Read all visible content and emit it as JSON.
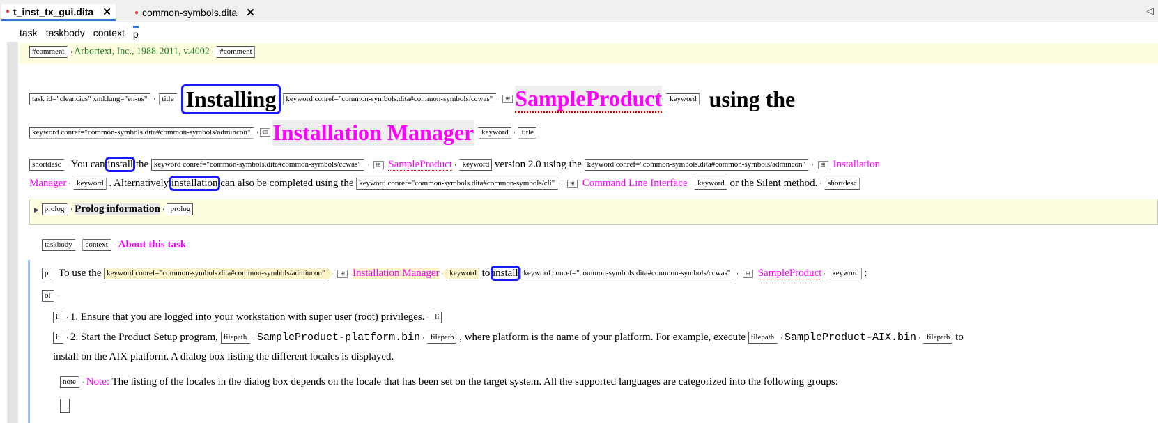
{
  "tabs": [
    {
      "label": "t_inst_tx_gui.dita"
    },
    {
      "label": "common-symbols.dita"
    }
  ],
  "scroll_arrow": "◁",
  "breadcrumb": [
    "task",
    "taskbody",
    "context",
    "p"
  ],
  "comment": {
    "tag": "#comment",
    "text": "Arbortext, Inc., 1988-2011, v.4002"
  },
  "title_line": {
    "task_tag": "task id=\"cleancics\" xml:lang=\"en-us\"",
    "title_tag": "title",
    "word1": "Installing",
    "kw1_tag": "keyword conref=\"common-symbols.dita#common-symbols/ccwas\"",
    "kw1": "SampleProduct",
    "kw_close": "keyword",
    "word2": "using the",
    "kw2_tag": "keyword conref=\"common-symbols.dita#common-symbols/admincon\"",
    "kw2": "Installation Manager",
    "title_close": "title"
  },
  "shortdesc": {
    "tag": "shortdesc",
    "t1": "You can",
    "install": "install",
    "t2": "the",
    "kw1_tag": "keyword conref=\"common-symbols.dita#common-symbols/ccwas\"",
    "kw1": "SampleProduct",
    "t3": "version 2.0 using the",
    "kw2_tag": "keyword conref=\"common-symbols.dita#common-symbols/admincon\"",
    "kw2a": "Installation",
    "kw2b": "Manager",
    "t4": ". Alternatively",
    "installation": "installation",
    "t5": "can also be completed using the",
    "kw3_tag": "keyword conref=\"common-symbols.dita#common-symbols/cli\"",
    "kw3": "Command Line Interface",
    "t6": "or the Silent method.",
    "kw_close": "keyword",
    "close": "shortdesc"
  },
  "prolog": {
    "tag": "prolog",
    "text": "Prolog information"
  },
  "context": {
    "taskbody": "taskbody",
    "tag": "context",
    "text": "About this task"
  },
  "para": {
    "tag": "p",
    "t1": "To use the",
    "kw1_tag": "keyword conref=\"common-symbols.dita#common-symbols/admincon\"",
    "kw1": "Installation Manager",
    "t2": "to",
    "install": "install",
    "kw2_tag": "keyword conref=\"common-symbols.dita#common-symbols/ccwas\"",
    "kw2": "SampleProduct",
    "colon": ":",
    "kw_close": "keyword"
  },
  "ol_tag": "ol",
  "li1": {
    "tag": "li",
    "text": "1. Ensure that you are logged into your workstation with super user (root) privileges."
  },
  "li2": {
    "tag": "li",
    "t1": "2. Start the Product Setup program,",
    "fp_tag": "filepath",
    "fp1": "SampleProduct-platform.bin",
    "t2": ", where platform is the name of your platform. For example, execute",
    "fp2": "SampleProduct-AIX.bin",
    "t3": "to",
    "t4": "install on the AIX platform. A dialog box listing the different locales is displayed."
  },
  "note": {
    "tag": "note",
    "label": "Note:",
    "text": "The listing of the locales in the dialog box depends on the locale that has been set on the target system. All the supported languages are categorized into the following groups:"
  }
}
